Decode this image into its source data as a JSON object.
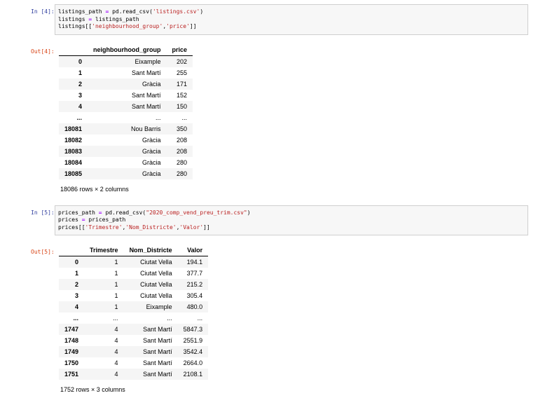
{
  "app": "jupyter-notebook",
  "colors": {
    "input_prompt": "#303F9F",
    "output_prompt": "#D84315",
    "code_cell_bg": "#F7F7F7",
    "code_cell_border": "#CFCFCF",
    "string_token": "#BA2121",
    "operator_token": "#AA22FF",
    "row_stripe": "#F5F5F5"
  },
  "cells": [
    {
      "in_label": "In [4]:",
      "out_label": "Out[4]:",
      "code_text": "listings_path = pd.read_csv('listings.csv')\nlistings = listings_path\nlistings[['neighbourhood_group','price']]",
      "code_tokens": [
        [
          {
            "t": "listings_path ",
            "c": "p"
          },
          {
            "t": "=",
            "c": "o"
          },
          {
            "t": " pd.read_csv(",
            "c": "p"
          },
          {
            "t": "'listings.csv'",
            "c": "s"
          },
          {
            "t": ")",
            "c": "p"
          }
        ],
        [
          {
            "t": "listings ",
            "c": "p"
          },
          {
            "t": "=",
            "c": "o"
          },
          {
            "t": " listings_path",
            "c": "p"
          }
        ],
        [
          {
            "t": "listings[[",
            "c": "p"
          },
          {
            "t": "'neighbourhood_group'",
            "c": "s"
          },
          {
            "t": ",",
            "c": "p"
          },
          {
            "t": "'price'",
            "c": "s"
          },
          {
            "t": "]]",
            "c": "p"
          }
        ]
      ],
      "table": {
        "columns": [
          "neighbourhood_group",
          "price"
        ],
        "rows": [
          {
            "index": "0",
            "values": [
              "Eixample",
              "202"
            ]
          },
          {
            "index": "1",
            "values": [
              "Sant Martí",
              "255"
            ]
          },
          {
            "index": "2",
            "values": [
              "Gràcia",
              "171"
            ]
          },
          {
            "index": "3",
            "values": [
              "Sant Martí",
              "152"
            ]
          },
          {
            "index": "4",
            "values": [
              "Sant Martí",
              "150"
            ]
          },
          {
            "index": "...",
            "values": [
              "...",
              "..."
            ]
          },
          {
            "index": "18081",
            "values": [
              "Nou Barris",
              "350"
            ]
          },
          {
            "index": "18082",
            "values": [
              "Gràcia",
              "208"
            ]
          },
          {
            "index": "18083",
            "values": [
              "Gràcia",
              "208"
            ]
          },
          {
            "index": "18084",
            "values": [
              "Gràcia",
              "280"
            ]
          },
          {
            "index": "18085",
            "values": [
              "Gràcia",
              "280"
            ]
          }
        ],
        "footer": "18086 rows × 2 columns"
      }
    },
    {
      "in_label": "In [5]:",
      "out_label": "Out[5]:",
      "code_text": "prices_path = pd.read_csv(\"2020_comp_vend_preu_trim.csv\")\nprices = prices_path\nprices[['Trimestre','Nom_Districte','Valor']]",
      "code_tokens": [
        [
          {
            "t": "prices_path ",
            "c": "p"
          },
          {
            "t": "=",
            "c": "o"
          },
          {
            "t": " pd.read_csv(",
            "c": "p"
          },
          {
            "t": "\"2020_comp_vend_preu_trim.csv\"",
            "c": "s"
          },
          {
            "t": ")",
            "c": "p"
          }
        ],
        [
          {
            "t": "prices ",
            "c": "p"
          },
          {
            "t": "=",
            "c": "o"
          },
          {
            "t": " prices_path",
            "c": "p"
          }
        ],
        [
          {
            "t": "prices[[",
            "c": "p"
          },
          {
            "t": "'Trimestre'",
            "c": "s"
          },
          {
            "t": ",",
            "c": "p"
          },
          {
            "t": "'Nom_Districte'",
            "c": "s"
          },
          {
            "t": ",",
            "c": "p"
          },
          {
            "t": "'Valor'",
            "c": "s"
          },
          {
            "t": "]]",
            "c": "p"
          }
        ]
      ],
      "table": {
        "columns": [
          "Trimestre",
          "Nom_Districte",
          "Valor"
        ],
        "rows": [
          {
            "index": "0",
            "values": [
              "1",
              "Ciutat Vella",
              "194.1"
            ]
          },
          {
            "index": "1",
            "values": [
              "1",
              "Ciutat Vella",
              "377.7"
            ]
          },
          {
            "index": "2",
            "values": [
              "1",
              "Ciutat Vella",
              "215.2"
            ]
          },
          {
            "index": "3",
            "values": [
              "1",
              "Ciutat Vella",
              "305.4"
            ]
          },
          {
            "index": "4",
            "values": [
              "1",
              "Eixample",
              "480.0"
            ]
          },
          {
            "index": "...",
            "values": [
              "...",
              "...",
              "..."
            ]
          },
          {
            "index": "1747",
            "values": [
              "4",
              "Sant Martí",
              "5847.3"
            ]
          },
          {
            "index": "1748",
            "values": [
              "4",
              "Sant Martí",
              "2551.9"
            ]
          },
          {
            "index": "1749",
            "values": [
              "4",
              "Sant Martí",
              "3542.4"
            ]
          },
          {
            "index": "1750",
            "values": [
              "4",
              "Sant Martí",
              "2664.0"
            ]
          },
          {
            "index": "1751",
            "values": [
              "4",
              "Sant Martí",
              "2108.1"
            ]
          }
        ],
        "footer": "1752 rows × 3 columns"
      }
    }
  ]
}
